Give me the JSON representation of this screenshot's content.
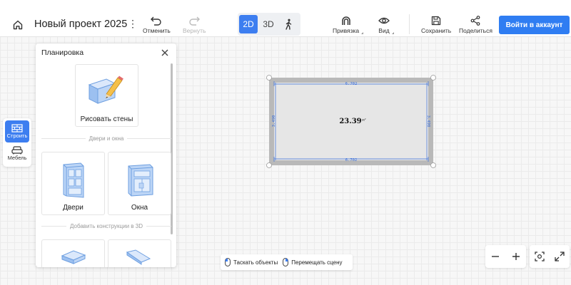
{
  "header": {
    "project_title": "Новый проект 2025",
    "undo_label": "Отменить",
    "redo_label": "Вернуть",
    "view_2d": "2D",
    "view_3d": "3D",
    "snap_label": "Привязка",
    "view_label": "Вид",
    "save_label": "Сохранить",
    "share_label": "Поделиться",
    "login_label": "Войти в аккаунт"
  },
  "rail": {
    "build_label": "Строить",
    "furniture_label": "Мебель"
  },
  "panel": {
    "title": "Планировка",
    "draw_walls_label": "Рисовать стены",
    "section_doors_windows": "Двери и окна",
    "doors_label": "Двери",
    "windows_label": "Окна",
    "section_3d": "Добавить конструкции в 3D"
  },
  "room": {
    "area_value": "23.39",
    "area_unit": "м²",
    "dim_top": "6.702",
    "dim_bottom": "6.702",
    "dim_left": "3.490",
    "dim_right": "3.490"
  },
  "hints": {
    "drag_objects": "Таскать объекты",
    "move_scene": "Перемещать сцену"
  },
  "colors": {
    "accent": "#2f7df2",
    "wall": "#b9b9b9",
    "floor": "#e6e6e6",
    "dimension": "#3b6fd8"
  }
}
